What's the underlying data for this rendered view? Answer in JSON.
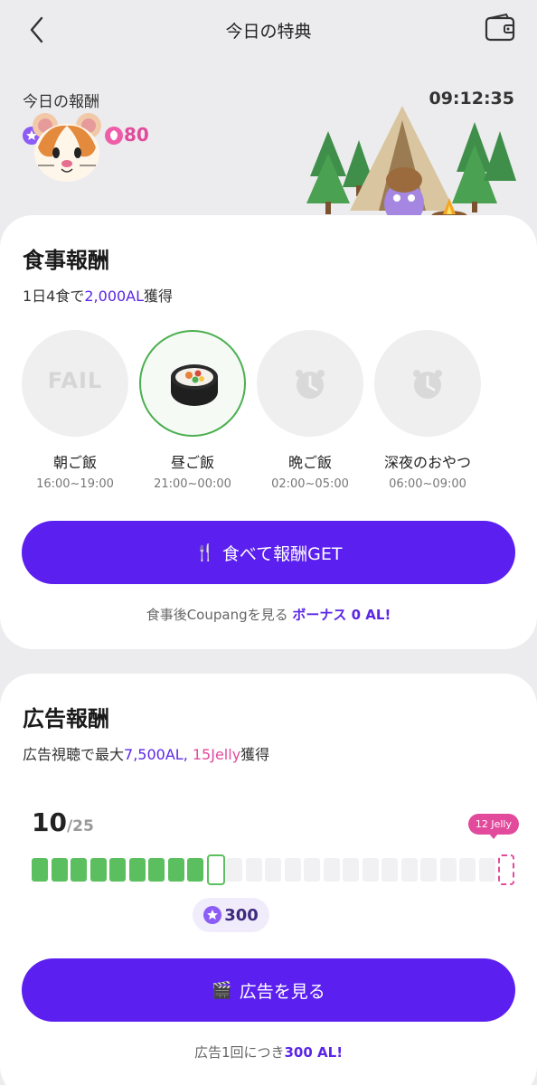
{
  "header": {
    "title": "今日の特典",
    "back_icon": "chevron-left-icon",
    "wallet_icon": "wallet-icon"
  },
  "today": {
    "label": "今日の報酬",
    "timer": "09:12:35",
    "reward_count": "80"
  },
  "meal": {
    "title": "食事報酬",
    "subtitle_pre": "1日4食で",
    "subtitle_amount": "2,000AL",
    "subtitle_post": "獲得",
    "items": [
      {
        "name": "朝ご飯",
        "time": "16:00~19:00",
        "status_text": "FAIL"
      },
      {
        "name": "昼ご飯",
        "time": "21:00~00:00"
      },
      {
        "name": "晩ご飯",
        "time": "02:00~05:00"
      },
      {
        "name": "深夜のおやつ",
        "time": "06:00~09:00"
      }
    ],
    "button_label": "食べて報酬GET",
    "note_pre": "食事後Coupangを見る",
    "note_bonus": "ボーナス 0 AL!"
  },
  "ad": {
    "title": "広告報酬",
    "subtitle_pre": "広告視聴で最大",
    "subtitle_al": "7,500AL",
    "subtitle_sep": ",",
    "subtitle_jelly": "15Jelly",
    "subtitle_post": "獲得",
    "progress_current": "10",
    "progress_total": "/25",
    "jelly_tag": "12 Jelly",
    "bonus_value": "300",
    "button_label": "広告を見る",
    "note_pre": "広告1回につき",
    "note_amount": "300 AL!"
  },
  "colors": {
    "primary": "#5b1ff0",
    "accent_purple": "#5b26e6",
    "accent_pink": "#e24a9c",
    "progress_green": "#5cbf5f"
  }
}
